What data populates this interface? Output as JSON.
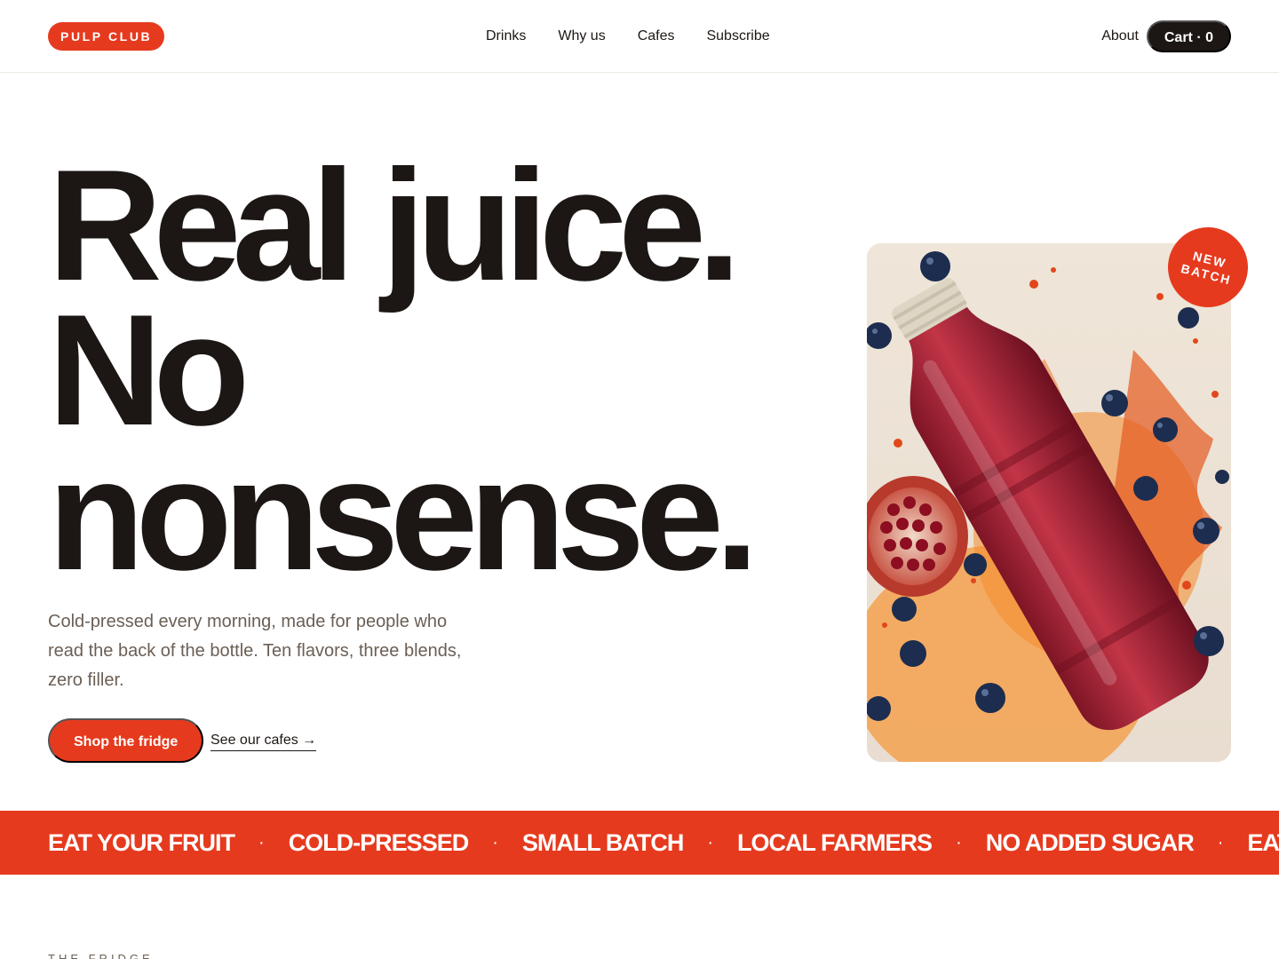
{
  "brand": {
    "logo": "PULP CLUB",
    "accent_color": "#e63a1e",
    "ink_color": "#1c1714"
  },
  "nav": {
    "items": [
      {
        "label": "Drinks"
      },
      {
        "label": "Why us"
      },
      {
        "label": "Cafes"
      },
      {
        "label": "Subscribe"
      }
    ]
  },
  "header": {
    "about": "About",
    "cart_label": "Cart · 0"
  },
  "hero": {
    "headline_lines": [
      "Real juice.",
      "No",
      "nonsense."
    ],
    "lede": "Cold-pressed every morning, made for people who read the back of the bottle. Ten flavors, three blends, zero filler.",
    "primary_cta": "Shop the fridge",
    "secondary_link": "See our cafes →"
  },
  "product_image": {
    "subject": "juice bottle with pomegranate and blueberries",
    "badge_lines": [
      "NEW",
      "BATCH"
    ]
  },
  "marquee": {
    "items": [
      "EAT YOUR FRUIT",
      "COLD-PRESSED",
      "SMALL BATCH",
      "LOCAL FARMERS",
      "NO ADDED SUGAR",
      "EAT YOUR FRUIT"
    ],
    "separator": "·"
  },
  "next_section": {
    "label": "THE FRIDGE"
  }
}
